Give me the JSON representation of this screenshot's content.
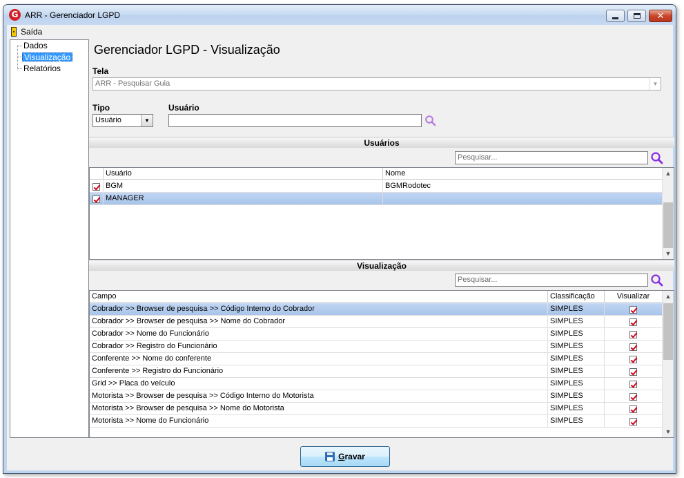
{
  "window": {
    "title": "ARR - Gerenciador LGPD",
    "app_icon_letter": "G"
  },
  "menu": {
    "exit_label": "Saída"
  },
  "tree": {
    "items": [
      {
        "label": "Dados",
        "selected": false
      },
      {
        "label": "Visualização",
        "selected": true
      },
      {
        "label": "Relatórios",
        "selected": false
      }
    ]
  },
  "page": {
    "title": "Gerenciador LGPD - Visualização"
  },
  "form": {
    "tela_label": "Tela",
    "tela_value": "ARR - Pesquisar Guia",
    "tipo_label": "Tipo",
    "tipo_value": "Usuário",
    "usuario_label": "Usuário",
    "usuario_value": ""
  },
  "usuarios_section": {
    "title": "Usuários",
    "search_placeholder": "Pesquisar...",
    "columns": [
      "Usuário",
      "Nome"
    ],
    "rows": [
      {
        "checked": true,
        "usuario": "BGM",
        "nome": "BGMRodotec",
        "selected": false
      },
      {
        "checked": true,
        "usuario": "MANAGER",
        "nome": "",
        "selected": true
      }
    ]
  },
  "visualizacao_section": {
    "title": "Visualização",
    "search_placeholder": "Pesquisar...",
    "columns": [
      "Campo",
      "Classificação",
      "Visualizar"
    ],
    "rows": [
      {
        "campo": "Cobrador >> Browser de pesquisa >> Código Interno do Cobrador",
        "classificacao": "SIMPLES",
        "visualizar": true,
        "selected": true
      },
      {
        "campo": "Cobrador >> Browser de pesquisa >> Nome do Cobrador",
        "classificacao": "SIMPLES",
        "visualizar": true,
        "selected": false
      },
      {
        "campo": "Cobrador >> Nome do Funcionário",
        "classificacao": "SIMPLES",
        "visualizar": true,
        "selected": false
      },
      {
        "campo": "Cobrador >> Registro do Funcionário",
        "classificacao": "SIMPLES",
        "visualizar": true,
        "selected": false
      },
      {
        "campo": "Conferente >> Nome do conferente",
        "classificacao": "SIMPLES",
        "visualizar": true,
        "selected": false
      },
      {
        "campo": "Conferente >> Registro do Funcionário",
        "classificacao": "SIMPLES",
        "visualizar": true,
        "selected": false
      },
      {
        "campo": "Grid >> Placa do veículo",
        "classificacao": "SIMPLES",
        "visualizar": true,
        "selected": false
      },
      {
        "campo": "Motorista >> Browser de pesquisa >> Código Interno do Motorista",
        "classificacao": "SIMPLES",
        "visualizar": true,
        "selected": false
      },
      {
        "campo": "Motorista >> Browser de pesquisa >> Nome do Motorista",
        "classificacao": "SIMPLES",
        "visualizar": true,
        "selected": false
      },
      {
        "campo": "Motorista >> Nome do Funcionário",
        "classificacao": "SIMPLES",
        "visualizar": true,
        "selected": false
      }
    ]
  },
  "footer": {
    "save_label": "Gravar"
  },
  "colors": {
    "selection_blue": "#3399ff",
    "row_selected": "#b4cdf0",
    "check_red": "#d0021b",
    "search_icon_purple": "#8a2be2"
  }
}
